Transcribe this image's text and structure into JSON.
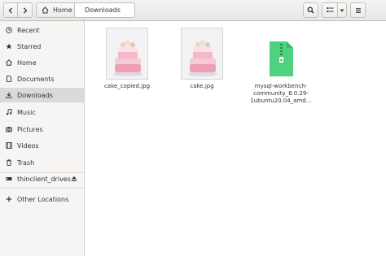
{
  "header": {
    "back_icon": "chevron-left-icon",
    "forward_icon": "chevron-right-icon",
    "path": [
      {
        "label": "Home",
        "icon": "home-icon"
      },
      {
        "label": "Downloads"
      }
    ],
    "search_icon": "search-icon",
    "view_icon": "grid-view-icon",
    "view_options_icon": "chevron-down-icon",
    "menu_icon": "hamburger-menu-icon"
  },
  "sidebar": {
    "items": [
      {
        "label": "Recent",
        "icon": "clock-icon"
      },
      {
        "label": "Starred",
        "icon": "star-icon"
      },
      {
        "label": "Home",
        "icon": "home-icon"
      },
      {
        "label": "Documents",
        "icon": "document-icon"
      },
      {
        "label": "Downloads",
        "icon": "download-icon",
        "selected": true
      },
      {
        "label": "Music",
        "icon": "music-icon"
      },
      {
        "label": "Pictures",
        "icon": "camera-icon"
      },
      {
        "label": "Videos",
        "icon": "film-icon"
      },
      {
        "label": "Trash",
        "icon": "trash-icon"
      },
      {
        "label": "thinclient_drives",
        "icon": "drive-icon",
        "eject_icon": "eject-icon"
      },
      {
        "label": "Other Locations",
        "icon": "plus-icon"
      }
    ]
  },
  "files": [
    {
      "name": "cake_copied.jpg",
      "type": "image"
    },
    {
      "name": "cake.jpg",
      "type": "image"
    },
    {
      "name_lines": [
        "mysql-workbench-",
        "community_8.0.29-",
        "1ubuntu20.04_amd…"
      ],
      "type": "archive"
    }
  ],
  "colors": {
    "archive_green": "#4ed27f",
    "selected_bg": "#dcdad8"
  }
}
